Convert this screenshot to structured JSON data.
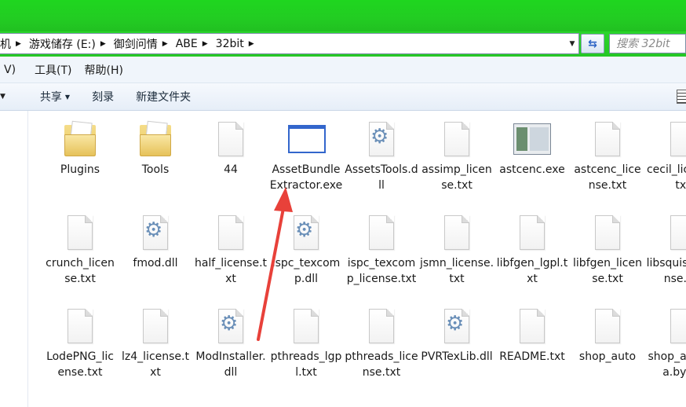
{
  "address": {
    "crumbs": [
      "机",
      "游戏储存 (E:)",
      "御剑问情",
      "ABE",
      "32bit"
    ],
    "search_placeholder": "搜索 32bit"
  },
  "menu": [
    "V)",
    "工具(T)",
    "帮助(H)"
  ],
  "commands": {
    "share": "共享",
    "burn": "刻录",
    "new_folder": "新建文件夹"
  },
  "files": [
    {
      "name": "Plugins",
      "kind": "folder"
    },
    {
      "name": "Tools",
      "kind": "folder"
    },
    {
      "name": "44",
      "kind": "file"
    },
    {
      "name": "AssetBundleExtractor.exe",
      "kind": "exe"
    },
    {
      "name": "AssetsTools.dll",
      "kind": "dll"
    },
    {
      "name": "assimp_license.txt",
      "kind": "txt"
    },
    {
      "name": "astcenc.exe",
      "kind": "app"
    },
    {
      "name": "astcenc_license.txt",
      "kind": "txt"
    },
    {
      "name": "cecil_license.txt",
      "kind": "txt"
    },
    {
      "name": "crunch_license.txt",
      "kind": "txt"
    },
    {
      "name": "fmod.dll",
      "kind": "dll"
    },
    {
      "name": "half_license.txt",
      "kind": "txt"
    },
    {
      "name": "ispc_texcomp.dll",
      "kind": "dll"
    },
    {
      "name": "ispc_texcomp_license.txt",
      "kind": "txt"
    },
    {
      "name": "jsmn_license.txt",
      "kind": "txt"
    },
    {
      "name": "libfgen_lgpl.txt",
      "kind": "txt"
    },
    {
      "name": "libfgen_license.txt",
      "kind": "txt"
    },
    {
      "name": "libsquish_license.txt",
      "kind": "txt"
    },
    {
      "name": "LodePNG_license.txt",
      "kind": "txt"
    },
    {
      "name": "lz4_license.txt",
      "kind": "txt"
    },
    {
      "name": "ModInstaller.dll",
      "kind": "dll"
    },
    {
      "name": "pthreads_lgpl.txt",
      "kind": "txt"
    },
    {
      "name": "pthreads_license.txt",
      "kind": "txt"
    },
    {
      "name": "PVRTexLib.dll",
      "kind": "dll"
    },
    {
      "name": "README.txt",
      "kind": "txt"
    },
    {
      "name": "shop_auto",
      "kind": "file"
    },
    {
      "name": "shop_auto.lua.bytes",
      "kind": "txt"
    }
  ],
  "colors": {
    "titlebar": "#22cc22",
    "annotation_arrow": "#e8413a",
    "gear": "#6a8fb8"
  }
}
